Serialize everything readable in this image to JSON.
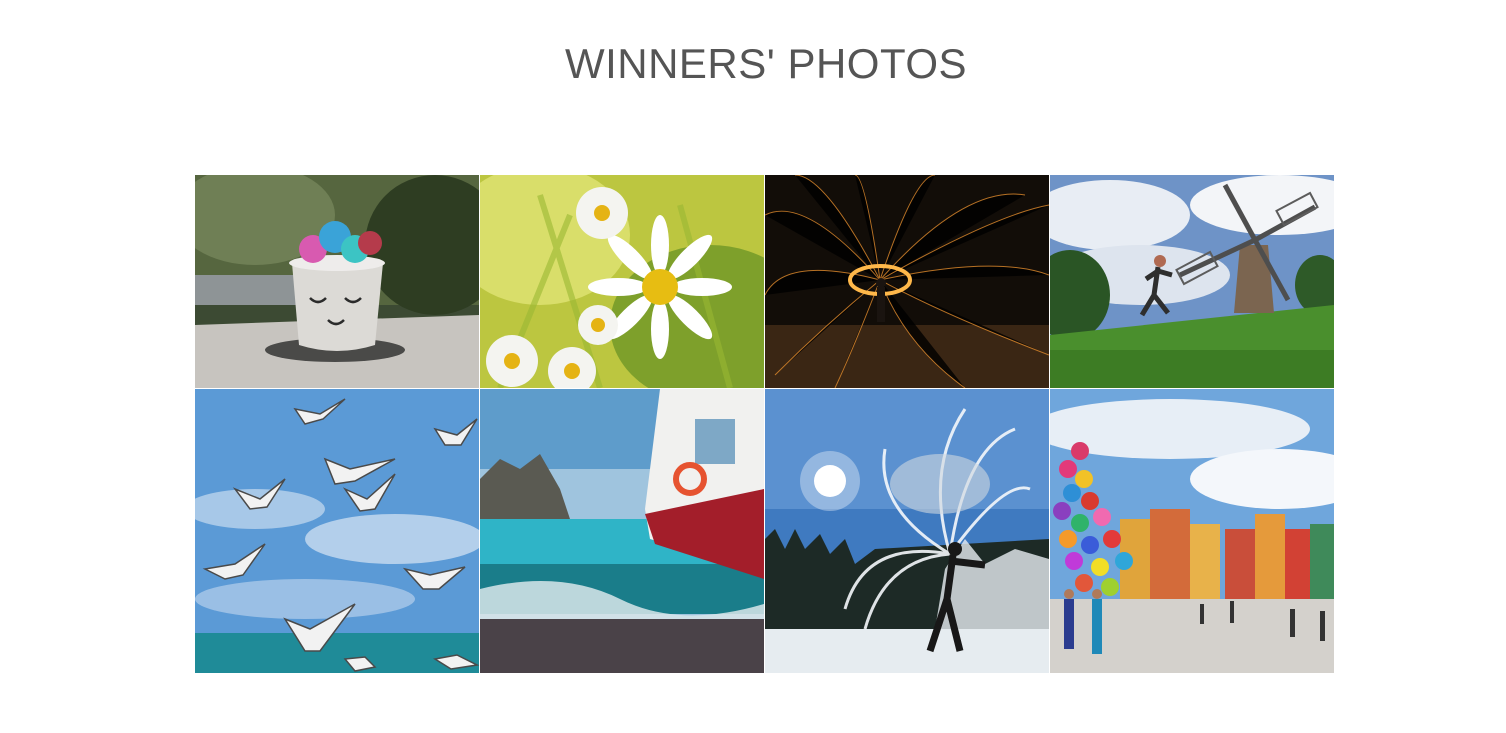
{
  "page": {
    "title": "WINNERS' PHOTOS"
  },
  "gallery": {
    "photos": [
      {
        "subject": "egg-cup-with-painted-eggs"
      },
      {
        "subject": "daisies-in-meadow"
      },
      {
        "subject": "steel-wool-fire-spinning"
      },
      {
        "subject": "woman-jumping-near-windmill"
      },
      {
        "subject": "seagulls-in-blue-sky"
      },
      {
        "subject": "boat-on-turquoise-sea"
      },
      {
        "subject": "person-throwing-boiling-water-in-frost"
      },
      {
        "subject": "balloons-in-old-town-square"
      }
    ]
  },
  "colors": {
    "title": "#555555",
    "background": "#ffffff"
  }
}
